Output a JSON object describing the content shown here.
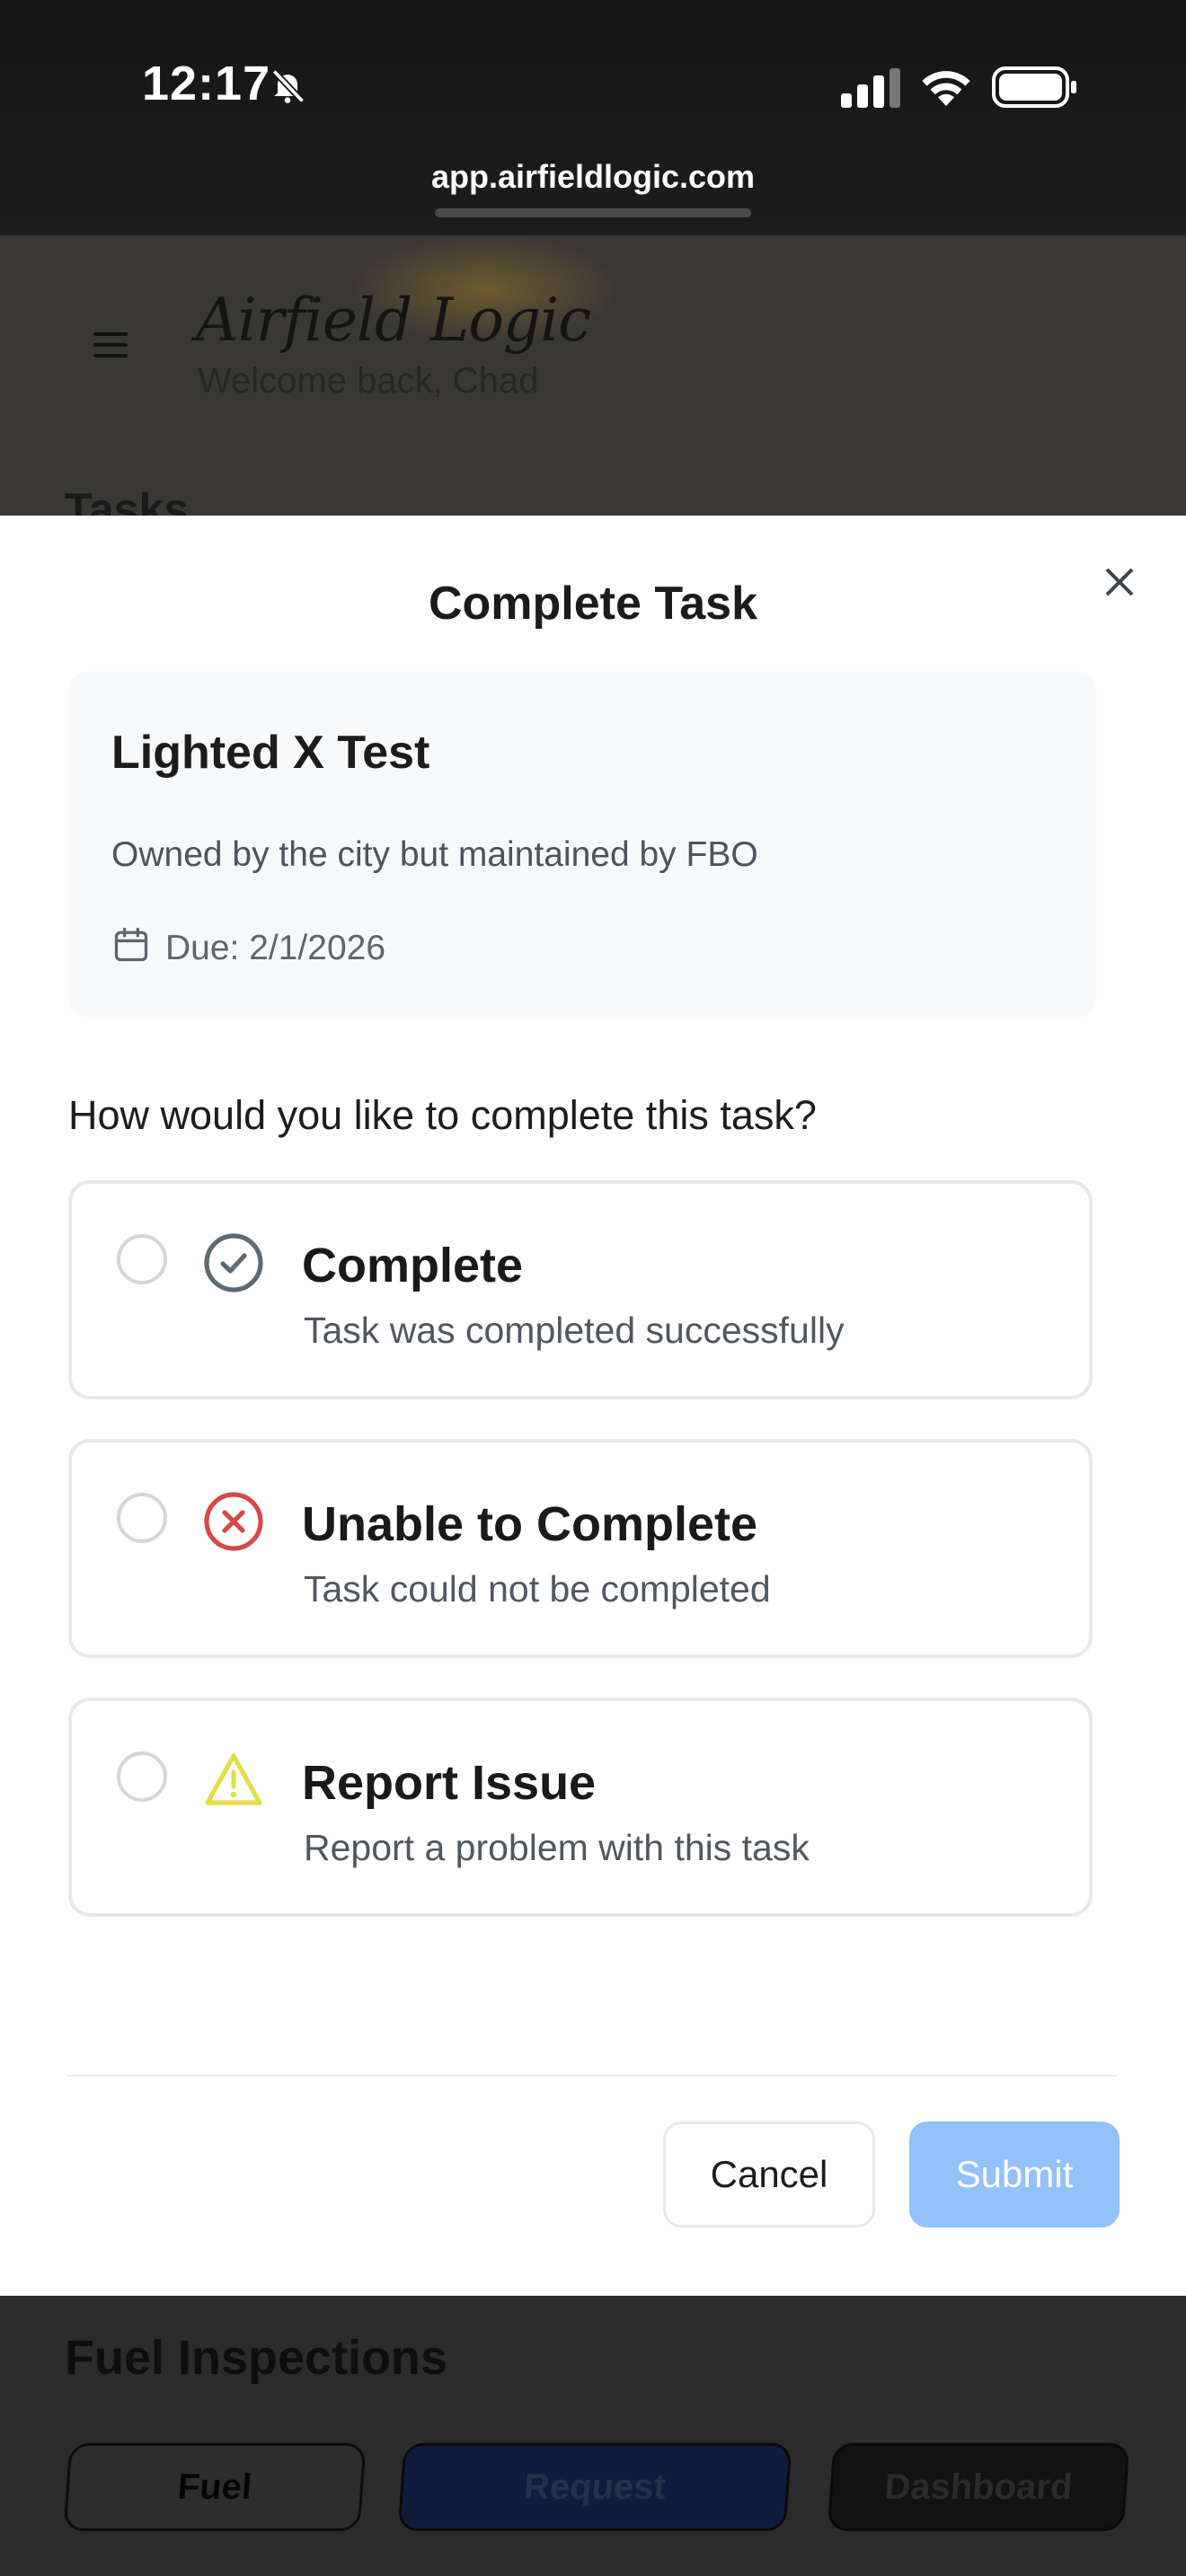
{
  "status_bar": {
    "time": "12:17",
    "url": "app.airfieldlogic.com"
  },
  "background_app": {
    "brand": "Airfield Logic",
    "welcome": "Welcome back, Chad",
    "section_peek": "Tasks",
    "fuel_title": "Fuel Inspections",
    "buttons": {
      "fuel": "Fuel",
      "request": "Request",
      "dashboard": "Dashboard"
    }
  },
  "modal": {
    "title": "Complete Task",
    "task": {
      "name": "Lighted X Test",
      "description": "Owned by the city but maintained by FBO",
      "due": "Due: 2/1/2026"
    },
    "question": "How would you like to complete this task?",
    "options": [
      {
        "title": "Complete",
        "subtitle": "Task was completed successfully",
        "icon": "check-circle-icon",
        "color": "#5f6b73",
        "selected": false
      },
      {
        "title": "Unable to Complete",
        "subtitle": "Task could not be completed",
        "icon": "x-circle-icon",
        "color": "#d84848",
        "selected": false
      },
      {
        "title": "Report Issue",
        "subtitle": "Report a problem with this task",
        "icon": "warning-triangle-icon",
        "color": "#e3df4a",
        "selected": false
      }
    ],
    "cancel_label": "Cancel",
    "submit_label": "Submit",
    "submit_color": "#93c1fb"
  }
}
